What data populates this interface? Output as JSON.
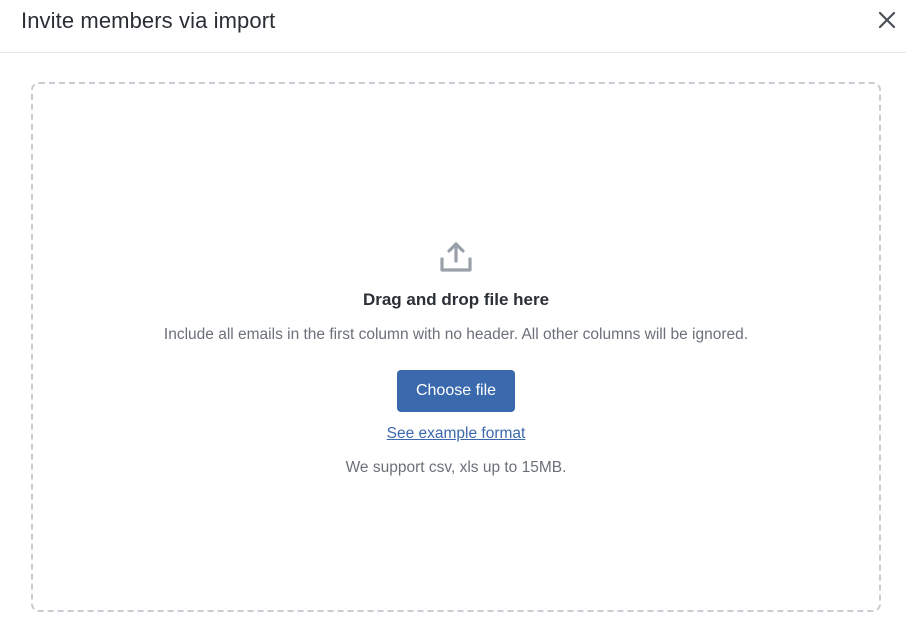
{
  "dialog": {
    "title": "Invite members via import",
    "close_icon": "close-icon"
  },
  "dropzone": {
    "icon": "upload-icon",
    "title": "Drag and drop file here",
    "hint": "Include all emails in the first column with no header. All other columns will be ignored.",
    "choose_button_label": "Choose file",
    "example_link_label": "See example format",
    "support_text": "We support csv, xls up to 15MB."
  },
  "colors": {
    "accent": "#3b69ad",
    "dashed_border": "#c9ccd3",
    "icon_gray": "#9aa0a9",
    "muted_text": "#6b7079"
  }
}
